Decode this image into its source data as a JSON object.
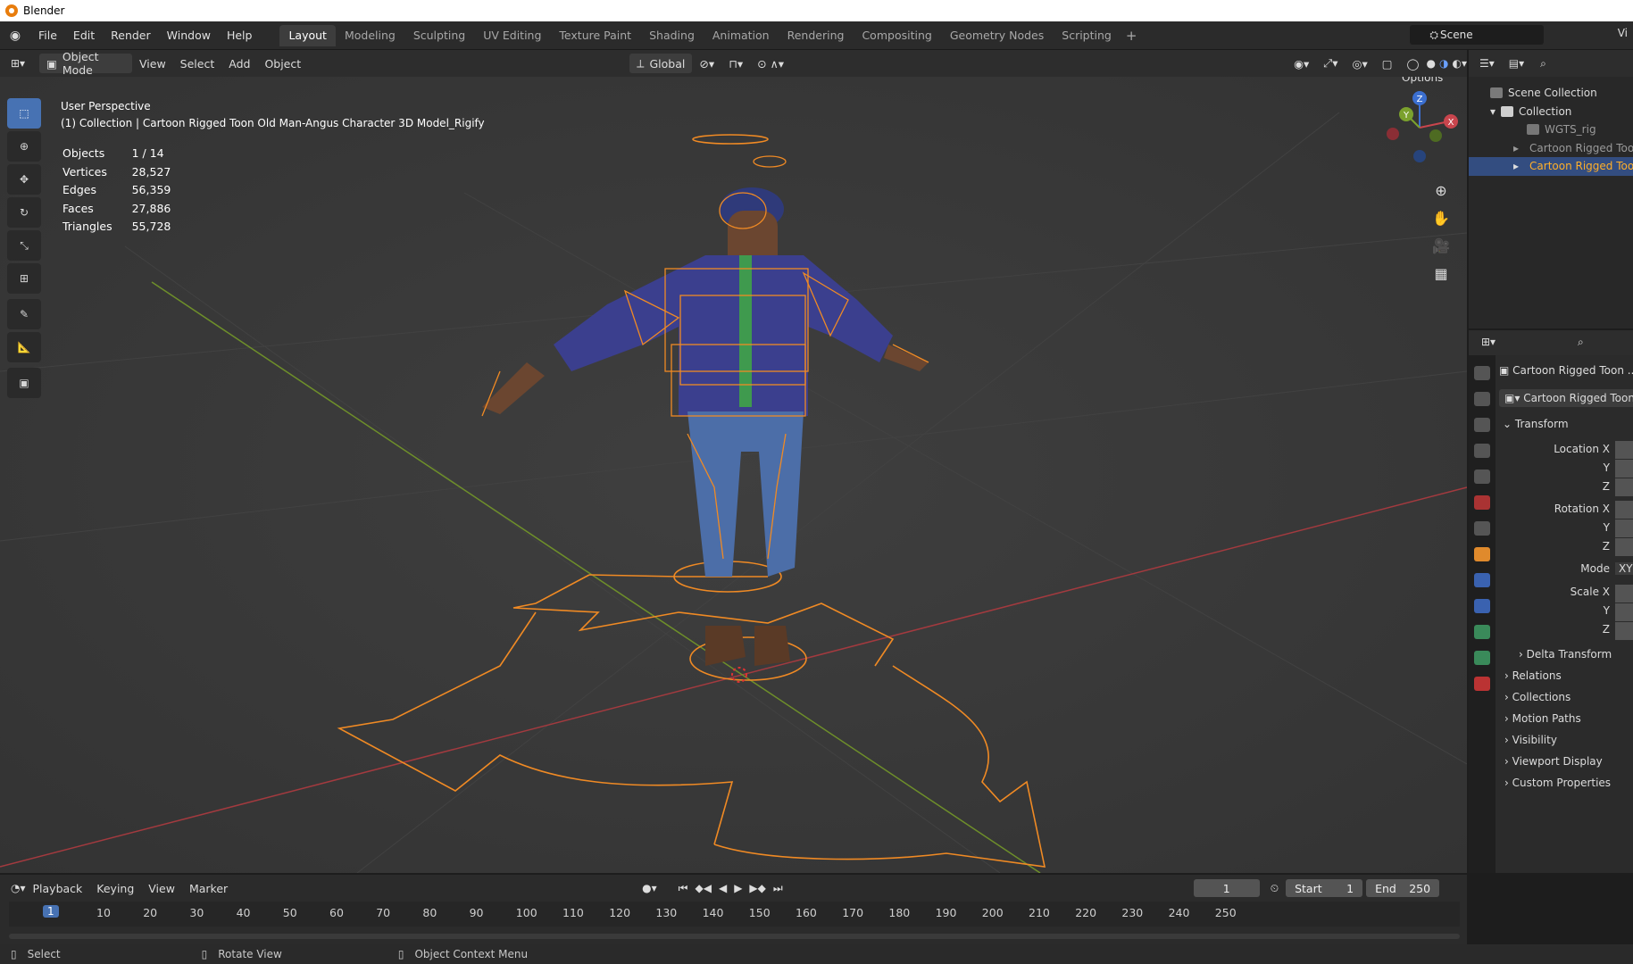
{
  "title_bar": {
    "app": "Blender"
  },
  "menu": [
    "File",
    "Edit",
    "Render",
    "Window",
    "Help"
  ],
  "workspaces": [
    {
      "label": "Layout",
      "active": true
    },
    {
      "label": "Modeling"
    },
    {
      "label": "Sculpting"
    },
    {
      "label": "UV Editing"
    },
    {
      "label": "Texture Paint"
    },
    {
      "label": "Shading"
    },
    {
      "label": "Animation"
    },
    {
      "label": "Rendering"
    },
    {
      "label": "Compositing"
    },
    {
      "label": "Geometry Nodes"
    },
    {
      "label": "Scripting"
    }
  ],
  "scene": {
    "name": "Scene",
    "view_layer_abbr": "Vi"
  },
  "viewport_header": {
    "mode": "Object Mode",
    "menus": [
      "View",
      "Select",
      "Add",
      "Object"
    ],
    "transform_orientation": "Global",
    "options": "Options"
  },
  "viewport": {
    "perspective": "User Perspective",
    "active_info": "(1) Collection | Cartoon Rigged Toon Old Man-Angus Character 3D Model_Rigify",
    "stats": [
      {
        "label": "Objects",
        "value": "1 / 14"
      },
      {
        "label": "Vertices",
        "value": "28,527"
      },
      {
        "label": "Edges",
        "value": "56,359"
      },
      {
        "label": "Faces",
        "value": "27,886"
      },
      {
        "label": "Triangles",
        "value": "55,728"
      }
    ],
    "gizmo_axes": [
      "Z",
      "Y",
      "X"
    ]
  },
  "outliner": {
    "rows": [
      {
        "label": "Scene Collection",
        "icon": "scene-collection-icon"
      },
      {
        "label": "Collection",
        "icon": "collection-icon"
      },
      {
        "label": "WGTS_rig",
        "icon": "collection-icon"
      },
      {
        "label": "Cartoon Rigged Toon",
        "icon": "armature-icon"
      },
      {
        "label": "Cartoon Rigged Toon",
        "icon": "armature-icon",
        "selected": true
      }
    ]
  },
  "properties": {
    "object_name": "Cartoon Rigged Toon ...",
    "object_data": "Cartoon Rigged Toon",
    "transform_label": "Transform",
    "location_label": "Location X",
    "rotation_label": "Rotation X",
    "mode_label": "Mode",
    "mode_value": "XYZ",
    "scale_label": "Scale X",
    "y_label": "Y",
    "z_label": "Z",
    "sections": [
      "Delta Transform",
      "Relations",
      "Collections",
      "Motion Paths",
      "Visibility",
      "Viewport Display",
      "Custom Properties"
    ]
  },
  "timeline": {
    "menus": [
      "Playback",
      "Keying",
      "View",
      "Marker"
    ],
    "current_frame": "1",
    "start_label": "Start",
    "start_value": "1",
    "end_label": "End",
    "end_value": "250",
    "ticks": [
      "10",
      "20",
      "30",
      "40",
      "50",
      "60",
      "70",
      "80",
      "90",
      "100",
      "110",
      "120",
      "130",
      "140",
      "150",
      "160",
      "170",
      "180",
      "190",
      "200",
      "210",
      "220",
      "230",
      "240",
      "250"
    ]
  },
  "statusbar": [
    "Select",
    "Rotate View",
    "Object Context Menu"
  ],
  "colors": {
    "accent": "#4772b3",
    "selection": "#f08a24",
    "bg": "#393939"
  }
}
